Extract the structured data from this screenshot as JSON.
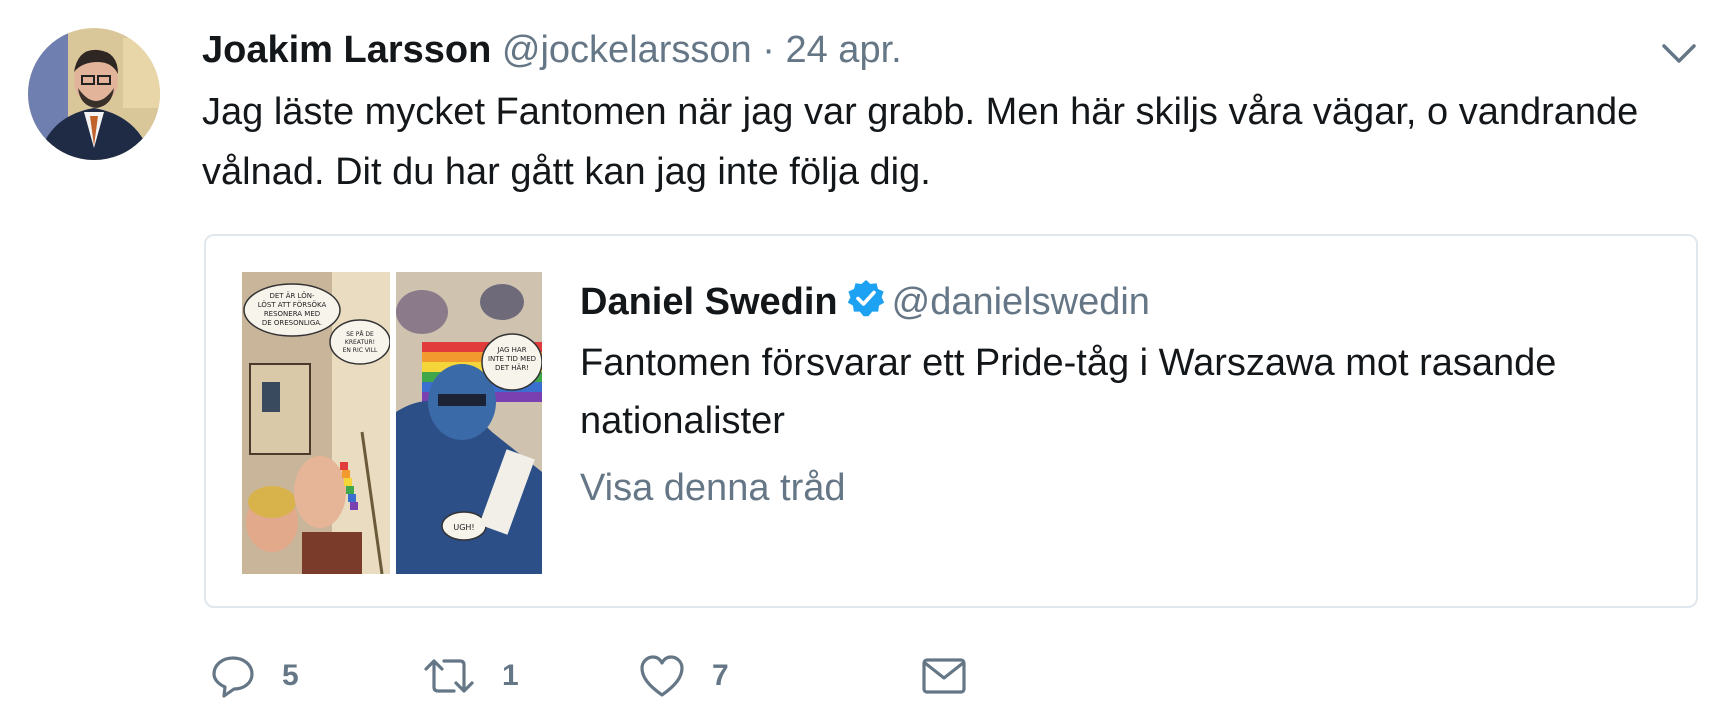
{
  "tweet": {
    "author": {
      "name": "Joakim Larsson",
      "handle": "@jockelarsson"
    },
    "separator": "·",
    "timestamp": "24 apr.",
    "text": "Jag läste mycket Fantomen när jag var grabb. Men här skiljs våra vägar, o vandrande vålnad. Dit du har gått kan jag inte följa dig.",
    "quoted": {
      "author": {
        "name": "Daniel Swedin",
        "handle": "@danielswedin",
        "verified": true
      },
      "text": "Fantomen försvarar ett Pride-tåg i Warszawa mot rasande nationalister",
      "thread_link": "Visa denna tråd",
      "comic_captions": [
        "DET ÄR LÖN-LÖST ATT FÖRSÖKA RESONERA MED DE ORESONLIGA.",
        "SE PÅ DE KREATUR! EN RIC VILL",
        "JAG HAR INTE TID MED DET HÄR!",
        "UGH!"
      ]
    },
    "actions": {
      "reply_count": "5",
      "retweet_count": "1",
      "like_count": "7"
    }
  },
  "icons": {
    "caret": "chevron-down-icon",
    "verified": "verified-badge-icon",
    "reply": "reply-icon",
    "retweet": "retweet-icon",
    "like": "heart-icon",
    "message": "envelope-icon"
  },
  "colors": {
    "text_primary": "#14171a",
    "text_secondary": "#657786",
    "border": "#e1e8ed",
    "verified_blue": "#1da1f2"
  }
}
